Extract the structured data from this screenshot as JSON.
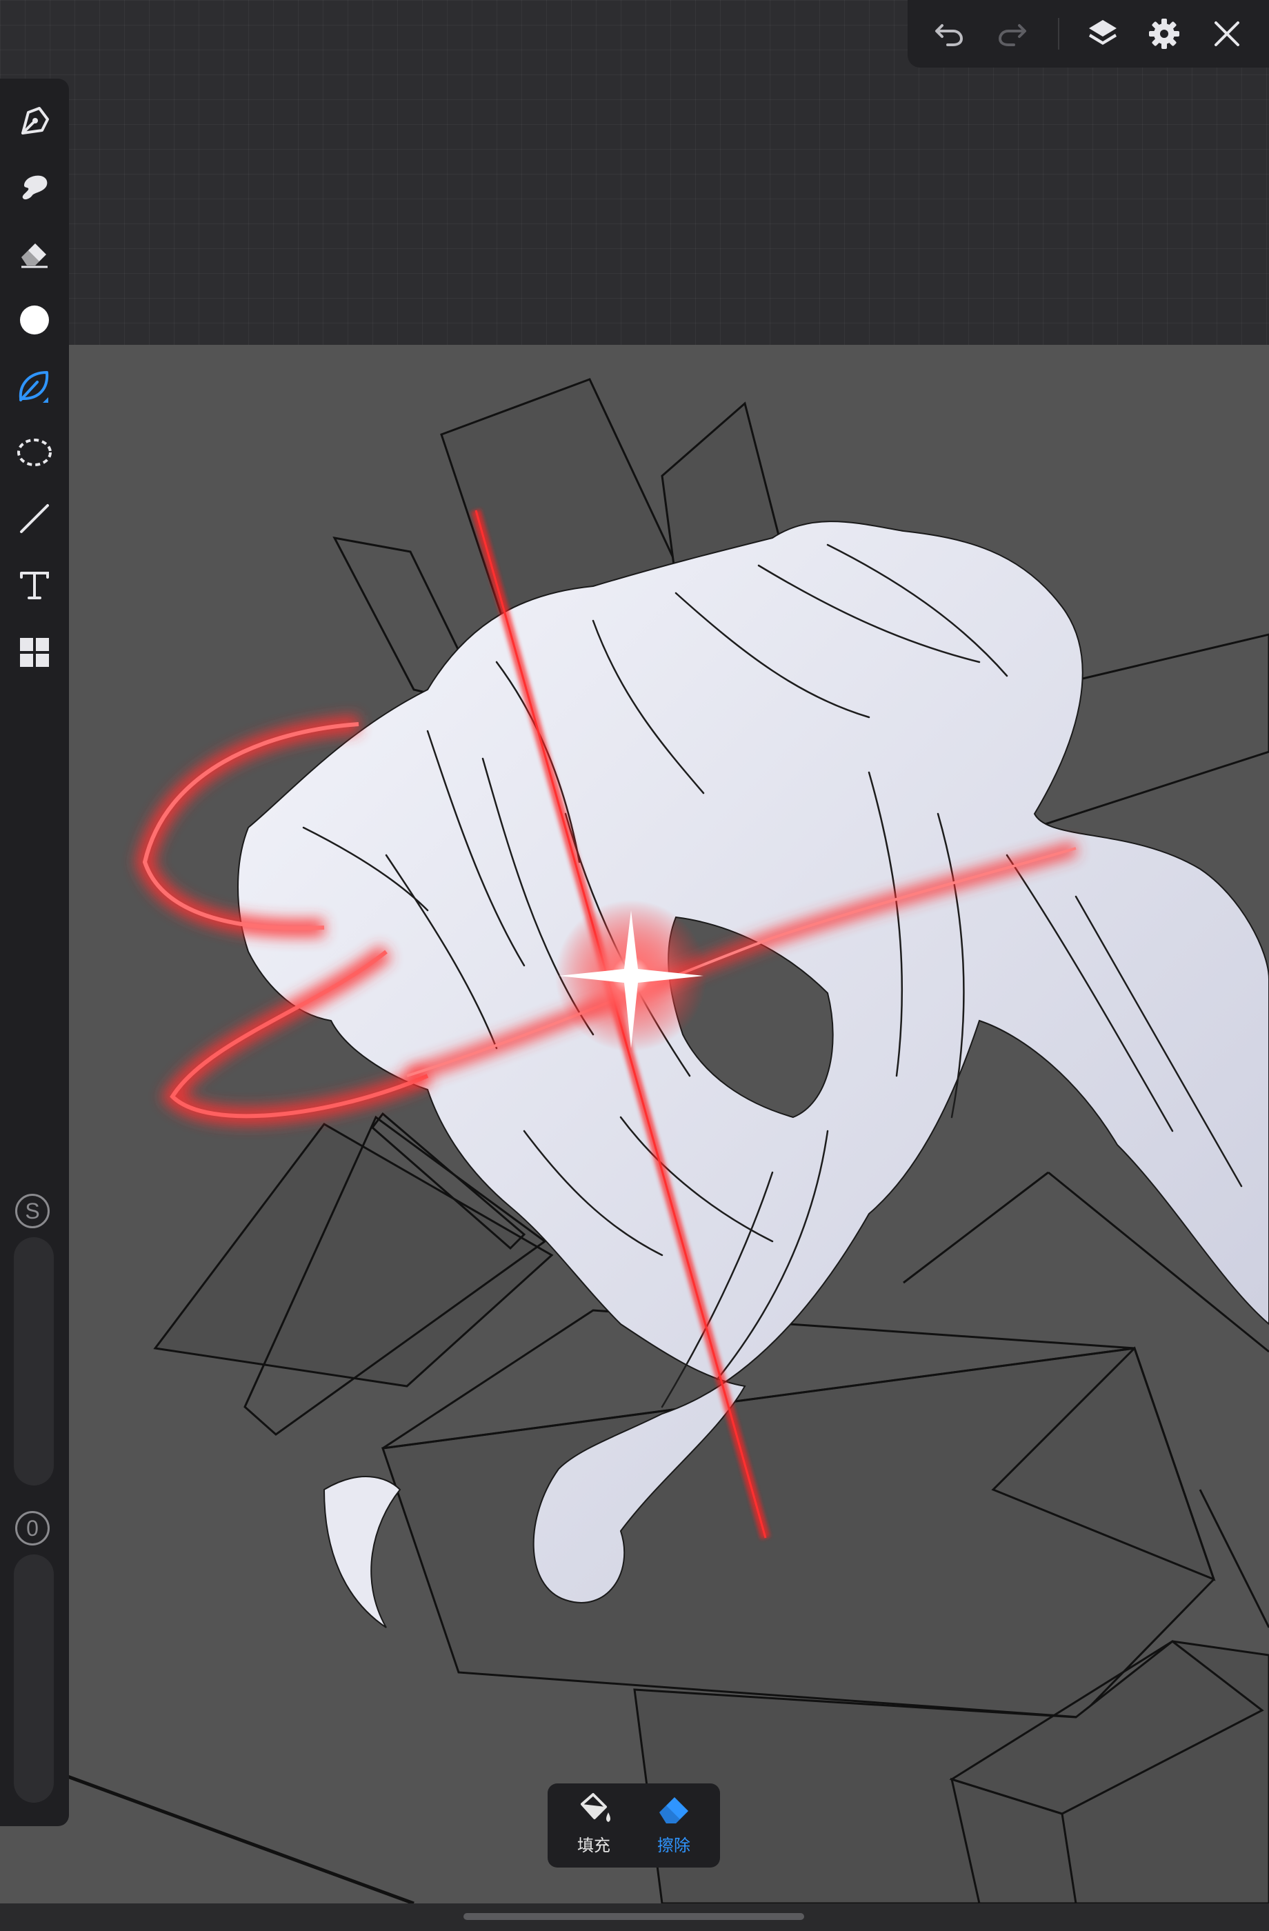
{
  "colors": {
    "accent": "#2f95ff",
    "toolbar_bg": "#1f1f22",
    "canvas_bg": "#545454",
    "glow_red": "#ff2a2a",
    "hair_white": "#e6e8f2"
  },
  "top_toolbar": {
    "undo_icon": "undo-arrow-icon",
    "redo_icon": "redo-arrow-icon",
    "layers_icon": "layers-icon",
    "settings_icon": "gear-icon",
    "close_icon": "close-x-icon"
  },
  "tools": [
    {
      "name": "pen",
      "icon": "pen-nib-icon"
    },
    {
      "name": "brush",
      "icon": "brush-icon"
    },
    {
      "name": "eraser",
      "icon": "eraser-icon"
    },
    {
      "name": "color",
      "icon": "color-swatch-icon",
      "value": "#ffffff"
    },
    {
      "name": "fill",
      "icon": "fill-leaf-icon",
      "active": true
    },
    {
      "name": "lasso",
      "icon": "lasso-icon"
    },
    {
      "name": "line",
      "icon": "line-icon"
    },
    {
      "name": "text",
      "icon": "text-icon"
    },
    {
      "name": "gallery",
      "icon": "grid-icon"
    }
  ],
  "sliders": {
    "size_label": "S",
    "opacity_label": "0"
  },
  "fill_panel": {
    "fill_label": "填充",
    "erase_label": "擦除",
    "active": "erase"
  }
}
